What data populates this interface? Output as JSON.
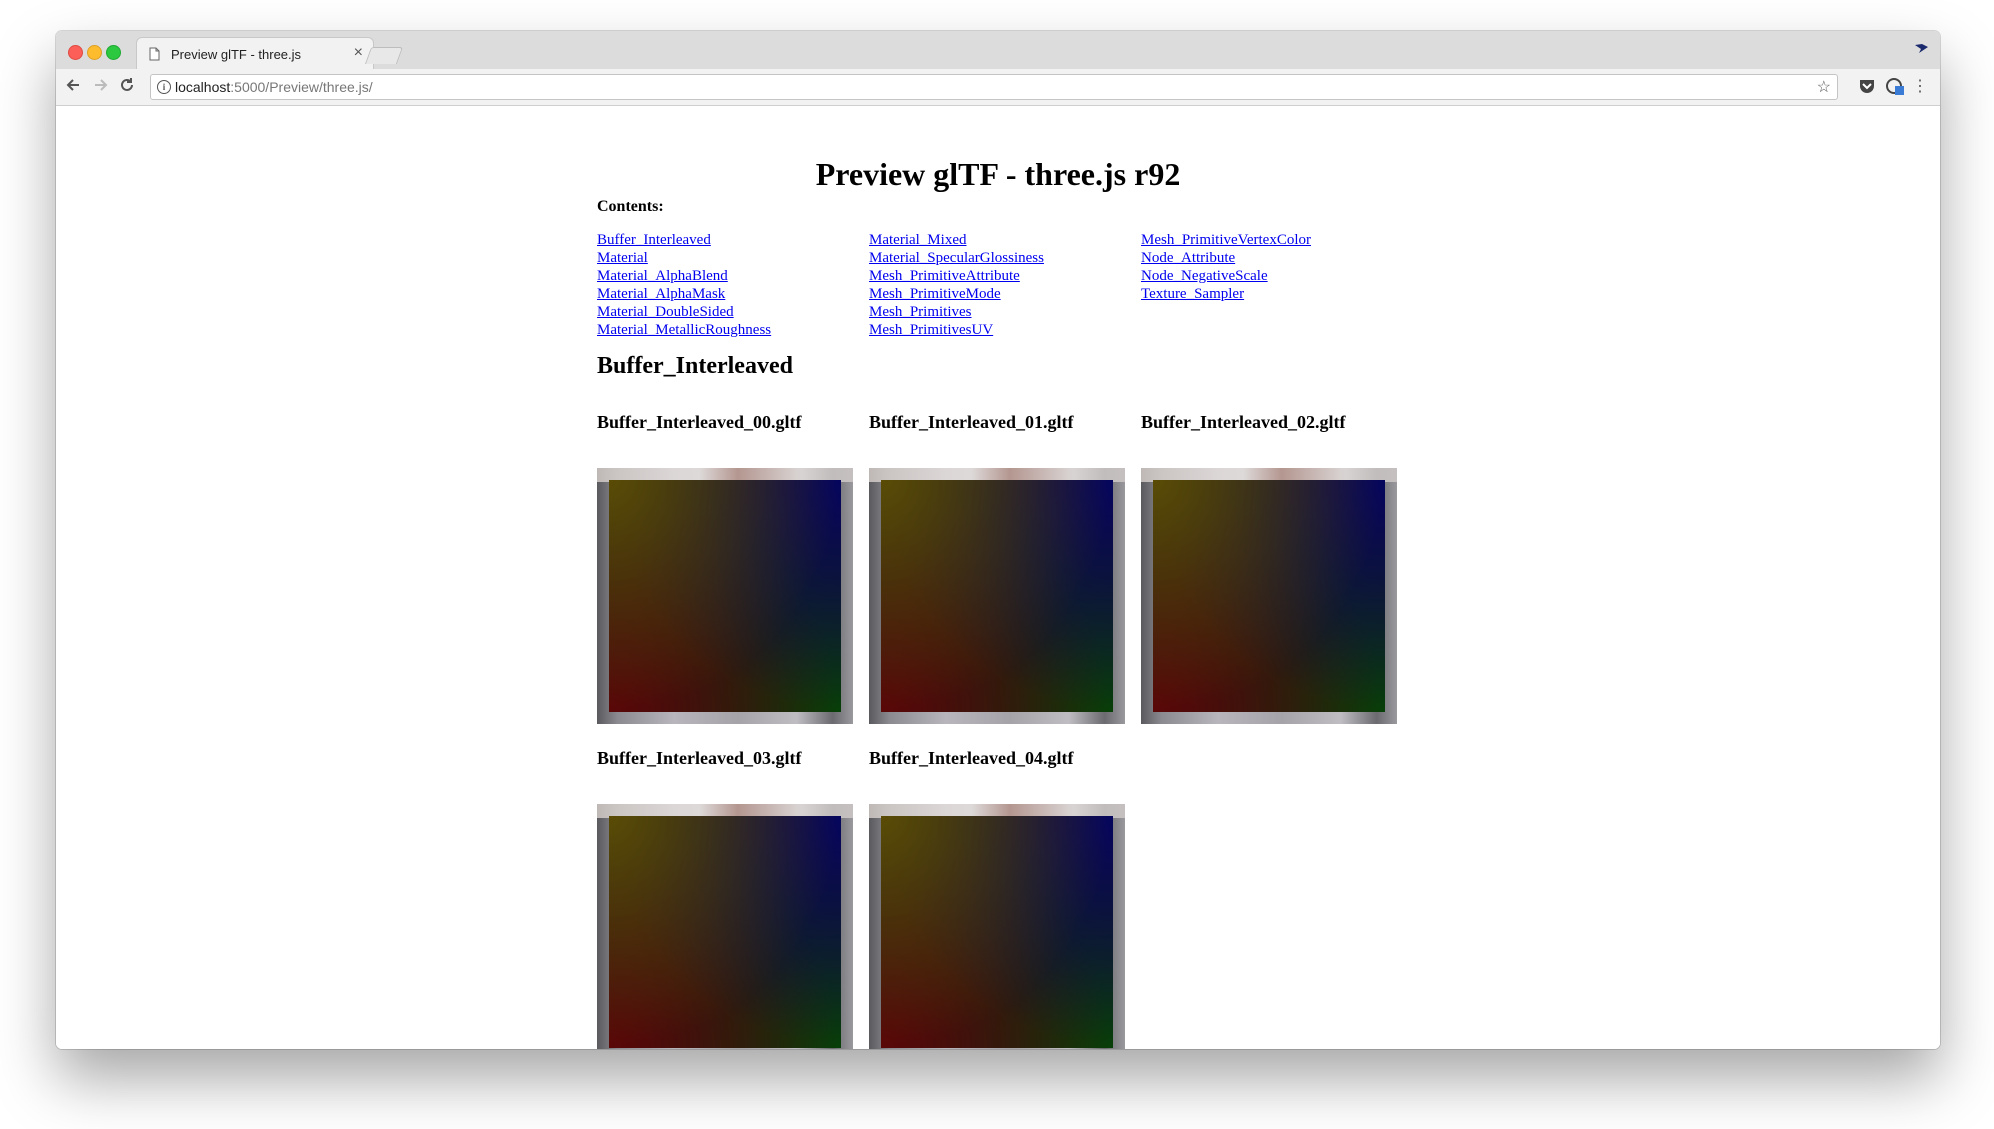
{
  "browser": {
    "tab_title": "Preview glTF - three.js",
    "tab_close": "×",
    "url_host": "localhost",
    "url_path": ":5000/Preview/three.js/",
    "icons": [
      "back-arrow-icon",
      "forward-arrow-icon",
      "reload-icon",
      "info-icon",
      "star-icon",
      "pocket-icon",
      "extension-icon",
      "menu-icon"
    ]
  },
  "page": {
    "title": "Preview glTF - three.js r92",
    "contents_label": "Contents:",
    "contents": {
      "col1": [
        "Buffer_Interleaved",
        "Material",
        "Material_AlphaBlend",
        "Material_AlphaMask",
        "Material_DoubleSided",
        "Material_MetallicRoughness"
      ],
      "col2": [
        "Material_Mixed",
        "Material_SpecularGlossiness",
        "Mesh_PrimitiveAttribute",
        "Mesh_PrimitiveMode",
        "Mesh_Primitives",
        "Mesh_PrimitivesUV"
      ],
      "col3": [
        "Mesh_PrimitiveVertexColor",
        "Node_Attribute",
        "Node_NegativeScale",
        "Texture_Sampler"
      ]
    },
    "section_title": "Buffer_Interleaved",
    "models": [
      "Buffer_Interleaved_00.gltf",
      "Buffer_Interleaved_01.gltf",
      "Buffer_Interleaved_02.gltf",
      "Buffer_Interleaved_03.gltf",
      "Buffer_Interleaved_04.gltf"
    ]
  }
}
